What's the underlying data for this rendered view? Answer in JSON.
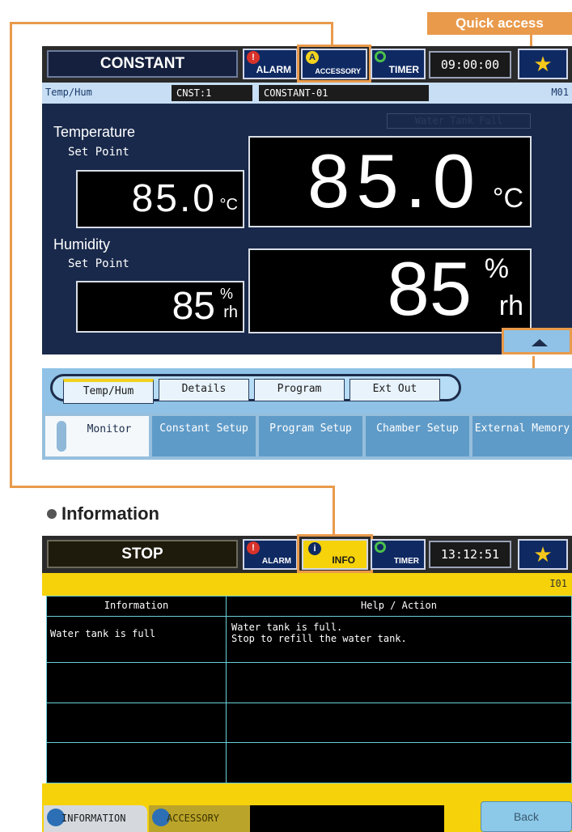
{
  "quick_access_label": "Quick access",
  "monitor_screen": {
    "mode": "CONSTANT",
    "header_buttons": {
      "alarm": "ALARM",
      "accessory": "ACCESSORY",
      "timer": "TIMER"
    },
    "clock": "09:00:00",
    "favorites_icon": "star-icon",
    "subbar": {
      "view": "Temp/Hum",
      "program_no": "CNST:1",
      "program_name": "CONSTANT-01",
      "right_code": "M01"
    },
    "status_text": "Water Tank Full",
    "temperature": {
      "label": "Temperature",
      "set_point_label": "Set Point",
      "set_point": "85.0",
      "current": "85.0",
      "unit": "°C"
    },
    "humidity": {
      "label": "Humidity",
      "set_point_label": "Set Point",
      "set_point": "85",
      "current": "85",
      "unit_top": "%",
      "unit_bottom": "rh"
    },
    "view_tabs": [
      "Temp/Hum",
      "Details",
      "Program",
      "Ext Out"
    ],
    "nav_tabs": [
      "Monitor",
      "Constant Setup",
      "Program Setup",
      "Chamber Setup",
      "External Memory"
    ]
  },
  "info_section_title": "Information",
  "info_screen": {
    "mode": "STOP",
    "header_buttons": {
      "alarm": "ALARM",
      "info": "INFO",
      "timer": "TIMER"
    },
    "clock": "13:12:51",
    "right_code": "I01",
    "table_headers": [
      "Information",
      "Help / Action"
    ],
    "rows": [
      {
        "information": "Water tank is full",
        "help": "Water tank is full.\nStop to refill the water tank."
      },
      {
        "information": "",
        "help": ""
      },
      {
        "information": "",
        "help": ""
      },
      {
        "information": "",
        "help": ""
      }
    ],
    "tabs": [
      "INFORMATION",
      "ACCESSORY"
    ],
    "back_button": "Back"
  },
  "colors": {
    "accent_orange": "#e99a4b",
    "monitor_panel": "#19294b",
    "info_yellow": "#f5d20a",
    "table_border": "#6ad0d6"
  }
}
